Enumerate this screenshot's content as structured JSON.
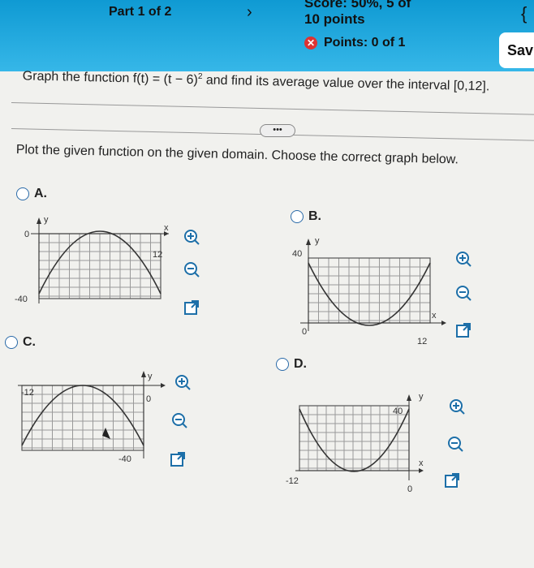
{
  "header": {
    "part": "Part 1 of 2",
    "score": "Score: 50%, 5 of",
    "points": "10 points",
    "points_of": "Points: 0 of 1",
    "save_label": "Sav"
  },
  "question": {
    "prefix": "Graph the function f(t) = (t − 6)",
    "exp": "2",
    "suffix": " and find its average value over the interval [0,12].",
    "more": "•••",
    "instruction": "Plot the given function on the given domain. Choose the correct graph below."
  },
  "options": [
    {
      "label": "A.",
      "y_top": "0",
      "y_bottom": "-40",
      "x_label": "12"
    },
    {
      "label": "B.",
      "y_top": "40",
      "y_bottom": "0",
      "x_label": "12"
    },
    {
      "label": "C.",
      "x_left": "-12",
      "x_origin": "0",
      "y_bottom": "-40"
    },
    {
      "label": "D.",
      "x_left": "-12",
      "y_top": "40",
      "x_origin": "0"
    }
  ],
  "axis": {
    "x": "x",
    "y": "y"
  },
  "icons": {
    "zoom_in": "zoom-in-icon",
    "zoom_out": "zoom-out-icon",
    "open": "open-new-window-icon"
  }
}
